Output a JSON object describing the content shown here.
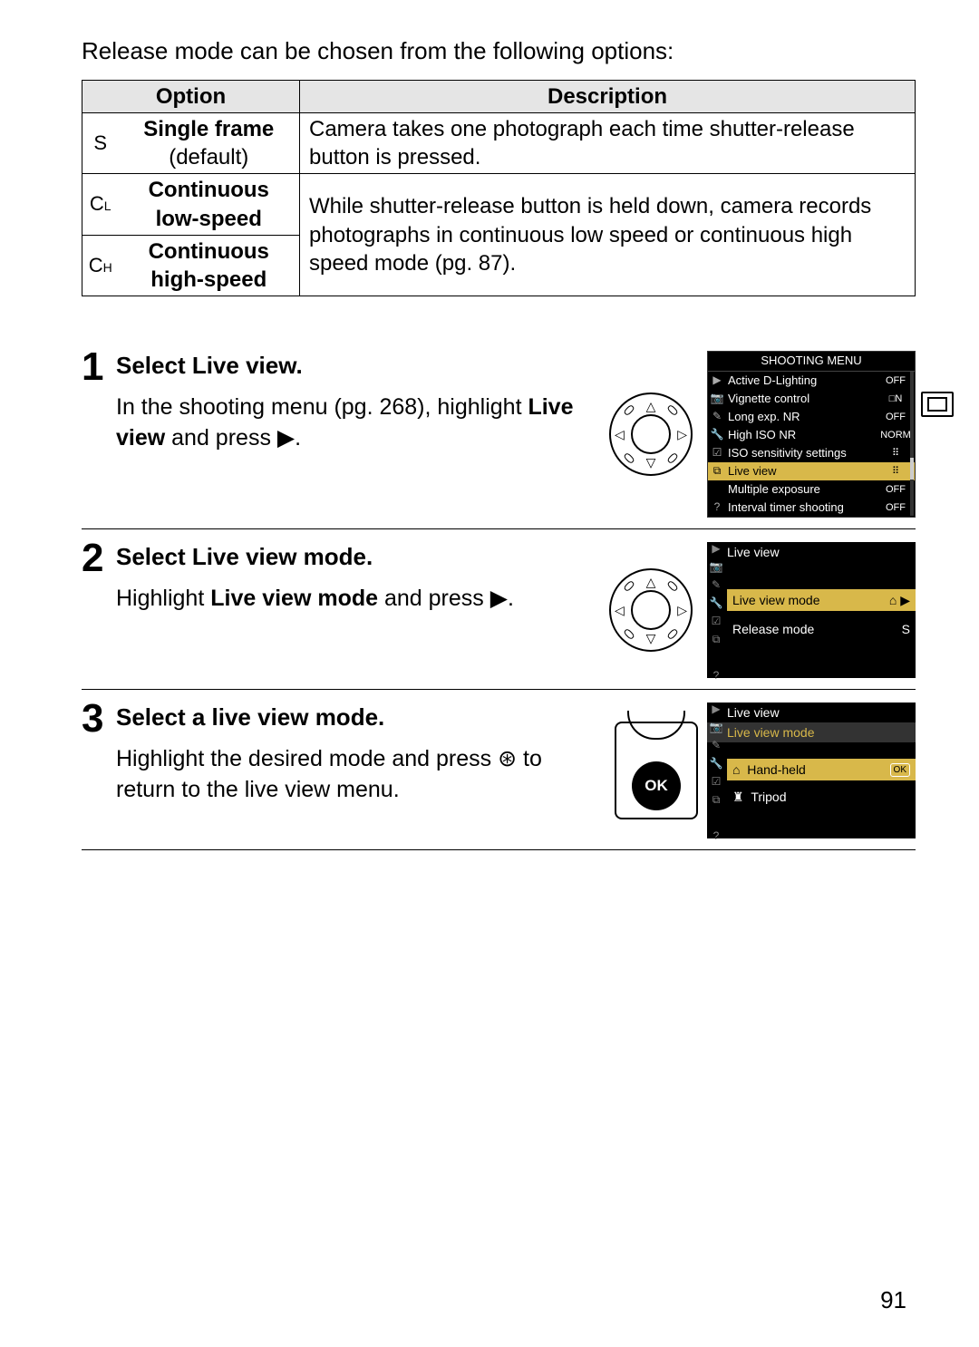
{
  "intro": "Release mode can be chosen from the following options:",
  "table": {
    "headers": {
      "option": "Option",
      "description": "Description"
    },
    "rows": [
      {
        "sym": "S",
        "name_bold": "Single frame",
        "name_sub": "(default)",
        "desc": "Camera takes one photograph each time shutter-release button is pressed."
      },
      {
        "sym": "Cʟ",
        "name_bold": "Continuous low-speed",
        "desc": ""
      },
      {
        "sym": "Cʜ",
        "name_bold": "Continuous high-speed",
        "desc": ""
      }
    ],
    "merged_desc": "While shutter-release button is held down, camera records photographs in continuous low speed or continuous high speed mode (pg. 87)."
  },
  "steps": [
    {
      "num": "1",
      "title": "Select Live view.",
      "desc_pre": "In the shooting menu (pg. 268), highlight ",
      "desc_bold": "Live view",
      "desc_post": " and press ▶.",
      "screen_title": "SHOOTING MENU",
      "menu": [
        {
          "icon": "▶",
          "label": "Active D-Lighting",
          "val": "OFF"
        },
        {
          "icon": "📷",
          "label": "Vignette control",
          "val": "□N"
        },
        {
          "icon": "✎",
          "label": "Long exp. NR",
          "val": "OFF"
        },
        {
          "icon": "🔧",
          "label": "High ISO NR",
          "val": "NORM"
        },
        {
          "icon": "☑",
          "label": "ISO sensitivity settings",
          "val": "⠿"
        },
        {
          "icon": "⧉",
          "label": "Live view",
          "val": "⠿",
          "hl": true
        },
        {
          "icon": "",
          "label": "Multiple exposure",
          "val": "OFF"
        },
        {
          "icon": "?",
          "label": "Interval timer shooting",
          "val": "OFF"
        }
      ]
    },
    {
      "num": "2",
      "title": "Select Live view mode.",
      "desc_pre": "Highlight ",
      "desc_bold": "Live view mode",
      "desc_post": " and press ▶.",
      "crumb": "Live view",
      "entries": [
        {
          "label": "Live view mode",
          "val": "⌂ ▶",
          "hl": true
        },
        {
          "label": "Release mode",
          "val": "S"
        }
      ]
    },
    {
      "num": "3",
      "title": "Select a live view mode.",
      "desc_pre": "Highlight the desired mode and press ",
      "desc_icon": "⊛",
      "desc_post": " to return to the live view menu.",
      "crumb1": "Live view",
      "crumb2": "Live view mode",
      "ok_label": "OK",
      "entries": [
        {
          "icon": "⌂",
          "label": "Hand-held",
          "hl": true,
          "ok": true
        },
        {
          "icon": "♜",
          "label": "Tripod"
        }
      ]
    }
  ],
  "page_number": "91"
}
